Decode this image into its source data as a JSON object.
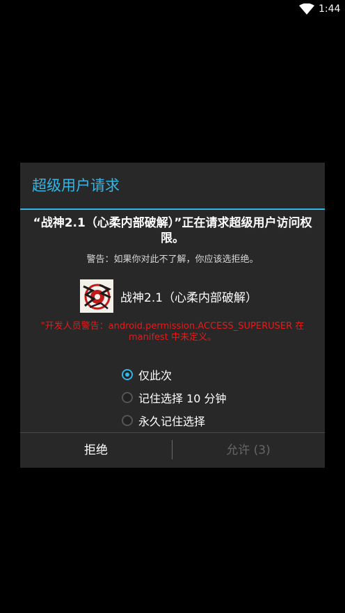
{
  "status_bar": {
    "time": "1:44",
    "wifi_icon": "wifi-icon"
  },
  "dialog": {
    "title": "超级用户请求",
    "question": "“战神2.1（心柔内部破解）”正在请求超级用户访问权限。",
    "warning": "警告：如果你对此不了解，你应该选拒绝。",
    "app": {
      "name": "战神2.1（心柔内部破解）",
      "icon": "app-icon"
    },
    "developer_warning": "\"开发人员警告：android.permission.ACCESS_SUPERUSER 在 manifest 中未定义。",
    "options": [
      {
        "label": "仅此次",
        "checked": true
      },
      {
        "label": "记住选择 10 分钟",
        "checked": false
      },
      {
        "label": "永久记住选择",
        "checked": false
      }
    ],
    "buttons": {
      "deny": "拒绝",
      "allow": "允许 (3)"
    },
    "colors": {
      "accent": "#33b5e5",
      "warning_red": "#e31b1b",
      "dialog_bg": "#282828"
    }
  }
}
